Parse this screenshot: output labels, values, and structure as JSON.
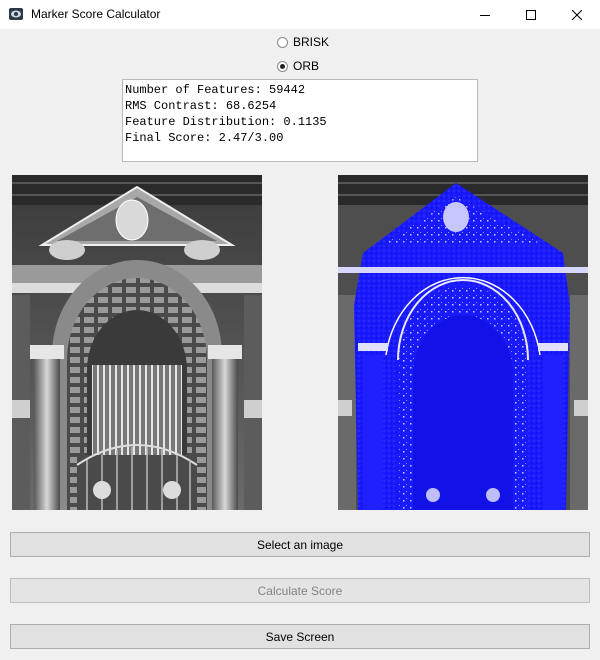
{
  "window": {
    "title": "Marker Score Calculator",
    "icon": "app-icon",
    "controls": [
      "minimize-icon",
      "maximize-icon",
      "close-icon"
    ]
  },
  "detector_options": [
    {
      "label": "BRISK",
      "selected": false
    },
    {
      "label": "ORB",
      "selected": true
    }
  ],
  "results": {
    "lines": [
      "Number of Features: 59442",
      "RMS Contrast: 68.6254",
      "Feature Distribution: 0.1135",
      "Final Score: 2.47/3.00"
    ]
  },
  "images": {
    "original": {
      "description_icon": "grayscale-photo",
      "tone": "grayscale"
    },
    "features": {
      "description_icon": "feature-overlay-photo",
      "overlay_color": "#1a1aff"
    }
  },
  "buttons": {
    "select_image": "Select an image",
    "calculate_score": "Calculate Score",
    "save_screen": "Save Screen"
  },
  "colors": {
    "background": "#f0f0f0",
    "feature_marker": "#1a1aff"
  }
}
